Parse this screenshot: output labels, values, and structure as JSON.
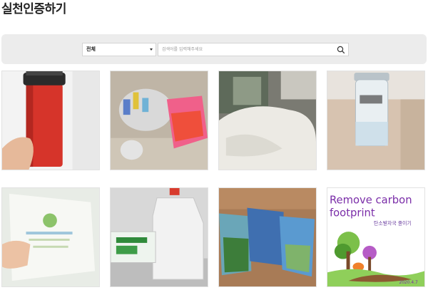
{
  "page": {
    "title": "실천인증하기"
  },
  "search": {
    "category_selected": "전체",
    "placeholder": "검색어를 입력해주세요"
  },
  "posts": [
    {
      "name": "red-tumbler-photo"
    },
    {
      "name": "recycling-bag-photo"
    },
    {
      "name": "hoodie-photo"
    },
    {
      "name": "water-bottle-photo"
    },
    {
      "name": "leaflet-photo"
    },
    {
      "name": "plastic-jug-photo"
    },
    {
      "name": "books-on-floor-photo"
    },
    {
      "name": "carbon-footprint-poster",
      "poster_title_line1": "Remove carbon",
      "poster_title_line2": "footprint",
      "poster_subtitle": "탄소발자국 줄이기",
      "poster_date": "2020.4.7"
    }
  ],
  "colors": {
    "accent": "#7a2da8",
    "panel": "#ececec"
  }
}
